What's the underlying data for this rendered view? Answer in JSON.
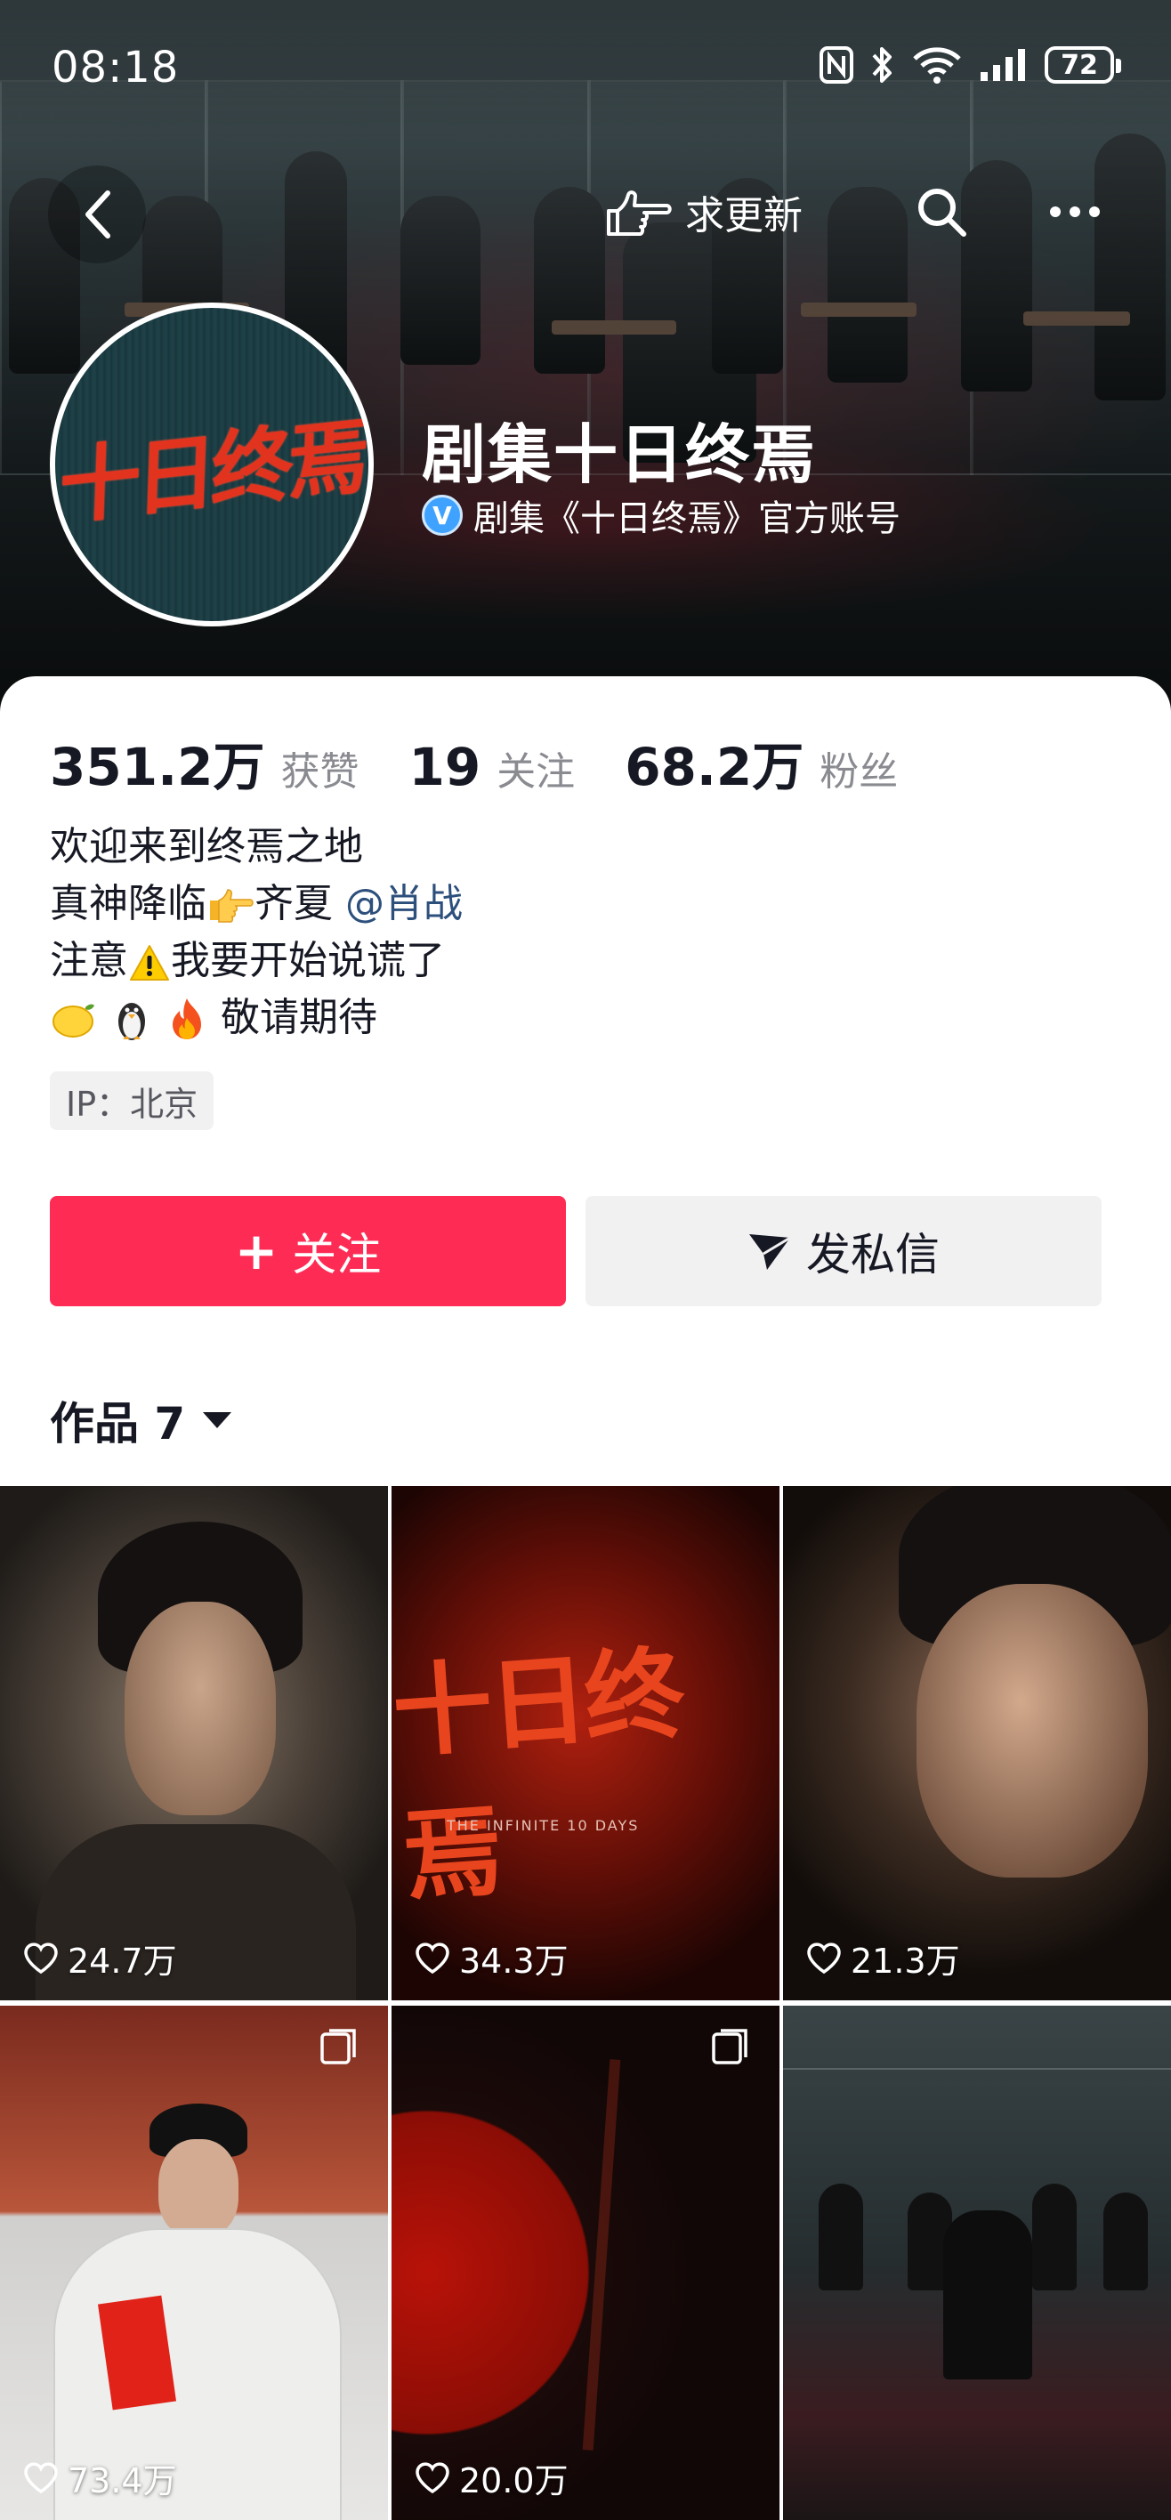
{
  "status_bar": {
    "time": "08:18",
    "battery": "72"
  },
  "nav": {
    "update_label": "求更新"
  },
  "profile": {
    "name": "剧集十日终焉",
    "verified_text": "剧集《十日终焉》官方账号",
    "avatar_logo": "十日终焉"
  },
  "stats": [
    {
      "num": "351.2万",
      "label": "获赞"
    },
    {
      "num": "19",
      "label": "关注"
    },
    {
      "num": "68.2万",
      "label": "粉丝"
    }
  ],
  "bio": {
    "line1": "欢迎来到终焉之地",
    "line2_a": "真神降临",
    "line2_b": "齐夏 ",
    "mention": "@肖战",
    "line3_a": "注意",
    "line3_b": "我要开始说谎了",
    "line4": " 敬请期待"
  },
  "ip": "IP：北京",
  "buttons": {
    "follow": "关注",
    "message": "发私信"
  },
  "works": {
    "label": "作品 7"
  },
  "grid": [
    {
      "likes": "24.7万"
    },
    {
      "likes": "34.3万",
      "title": "十日终焉",
      "subtitle": "THE INFINITE 10 DAYS"
    },
    {
      "likes": "21.3万"
    },
    {
      "likes": "73.4万"
    },
    {
      "likes": "20.0万"
    },
    {
      "likes": ""
    }
  ]
}
